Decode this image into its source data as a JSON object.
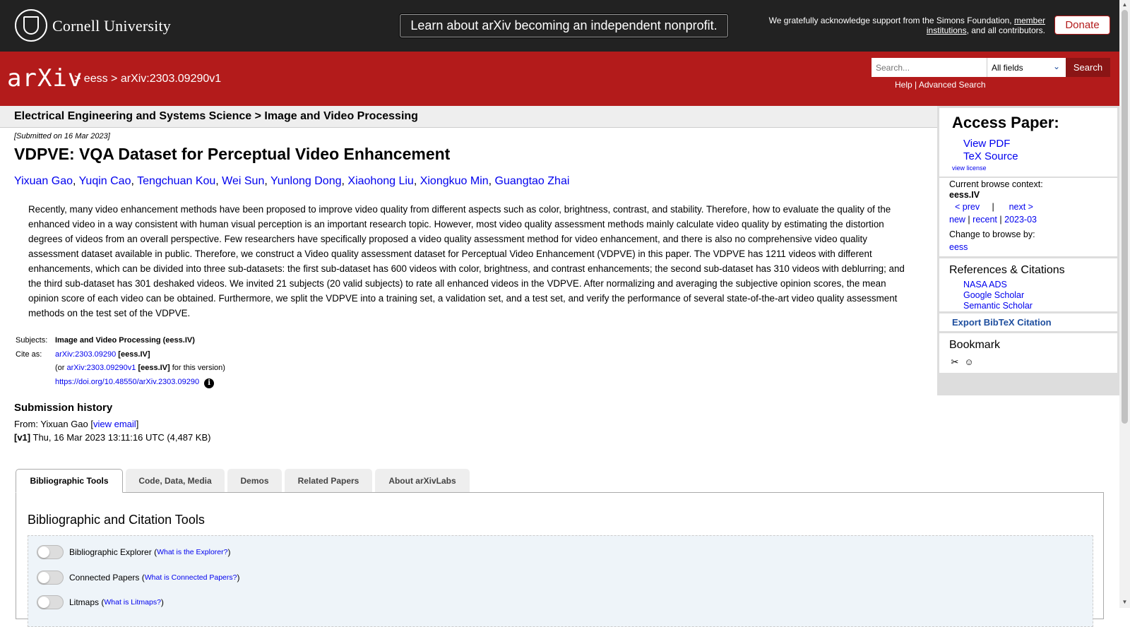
{
  "banner": {
    "university": "Cornell University",
    "nonprofit_button": "Learn about arXiv becoming an independent nonprofit.",
    "support_prefix": "We gratefully acknowledge support from the Simons Foundation,",
    "support_link": "member institutions",
    "support_suffix": ", and all contributors.",
    "donate_label": "Donate"
  },
  "header": {
    "logo": "arXiv",
    "breadcrumb_sep1": ">",
    "breadcrumb_archive": "eess",
    "breadcrumb_sep2": ">",
    "breadcrumb_id": "arXiv:2303.09290v1",
    "search_placeholder": "Search...",
    "search_field": "All fields",
    "search_button": "Search",
    "help_link": "Help",
    "links_sep": "|",
    "advanced_link": "Advanced Search"
  },
  "subject_bar": "Electrical Engineering and Systems Science > Image and Video Processing",
  "paper": {
    "submitted": "[Submitted on 16 Mar 2023]",
    "title": "VDPVE: VQA Dataset for Perceptual Video Enhancement",
    "authors": [
      "Yixuan Gao",
      "Yuqin Cao",
      "Tengchuan Kou",
      "Wei Sun",
      "Yunlong Dong",
      "Xiaohong Liu",
      "Xiongkuo Min",
      "Guangtao Zhai"
    ],
    "author_sep": ", ",
    "abstract": "Recently, many video enhancement methods have been proposed to improve video quality from different aspects such as color, brightness, contrast, and stability. Therefore, how to evaluate the quality of the enhanced video in a way consistent with human visual perception is an important research topic. However, most video quality assessment methods mainly calculate video quality by estimating the distortion degrees of videos from an overall perspective. Few researchers have specifically proposed a video quality assessment method for video enhancement, and there is also no comprehensive video quality assessment dataset available in public. Therefore, we construct a Video quality assessment dataset for Perceptual Video Enhancement (VDPVE) in this paper. The VDPVE has 1211 videos with different enhancements, which can be divided into three sub-datasets: the first sub-dataset has 600 videos with color, brightness, and contrast enhancements; the second sub-dataset has 310 videos with deblurring; and the third sub-dataset has 301 deshaked videos. We invited 21 subjects (20 valid subjects) to rate all enhanced videos in the VDPVE. After normalizing and averaging the subjective opinion scores, the mean opinion score of each video can be obtained. Furthermore, we split the VDPVE into a training set, a validation set, and a test set, and verify the performance of several state-of-the-art video quality assessment methods on the test set of the VDPVE.",
    "subjects_label": "Subjects:",
    "subjects_value": "Image and Video Processing (eess.IV)",
    "cite_label": "Cite as:",
    "cite_id": "arXiv:2303.09290",
    "cite_cat": "[eess.IV]",
    "cite_version_prefix": "(or",
    "cite_version_id": "arXiv:2303.09290v1",
    "cite_version_cat": "[eess.IV]",
    "cite_version_suffix": "for this version)",
    "doi": "https://doi.org/10.48550/arXiv.2303.09290",
    "info_icon": "i"
  },
  "history": {
    "heading": "Submission history",
    "from_prefix": "From: Yixuan Gao [",
    "view_email": "view email",
    "from_suffix": "]",
    "v1_tag": "[v1]",
    "v1_text": "Thu, 16 Mar 2023 13:11:16 UTC (4,487 KB)"
  },
  "tabs": [
    "Bibliographic Tools",
    "Code, Data, Media",
    "Demos",
    "Related Papers",
    "About arXivLabs"
  ],
  "panel": {
    "title": "Bibliographic and Citation Tools",
    "toggles": [
      {
        "label": "Bibliographic Explorer",
        "open": "(",
        "link": "What is the Explorer?",
        "close": ")"
      },
      {
        "label": "Connected Papers",
        "open": "(",
        "link": "What is Connected Papers?",
        "close": ")"
      },
      {
        "label": "Litmaps",
        "open": "(",
        "link": "What is Litmaps?",
        "close": ")"
      }
    ]
  },
  "sidebar": {
    "access_heading": "Access Paper:",
    "view_pdf": "View PDF",
    "tex_source": "TeX Source",
    "view_license": "view license",
    "context_label": "Current browse context:",
    "context_value": "eess.IV",
    "prev": "< prev",
    "nav_sep": "|",
    "next": "next >",
    "new": "new",
    "recent": "recent",
    "month": "2023-03",
    "change_label": "Change to browse by:",
    "change_value": "eess",
    "refs_heading": "References & Citations",
    "refs": [
      "NASA ADS",
      "Google Scholar",
      "Semantic Scholar"
    ],
    "export": "Export BibTeX Citation",
    "bookmark_heading": "Bookmark"
  },
  "colors": {
    "banner_bg": "#222222",
    "arxiv_red": "#b31b1b",
    "link_blue": "#0000ee",
    "panel_bg": "#eef4f9"
  }
}
